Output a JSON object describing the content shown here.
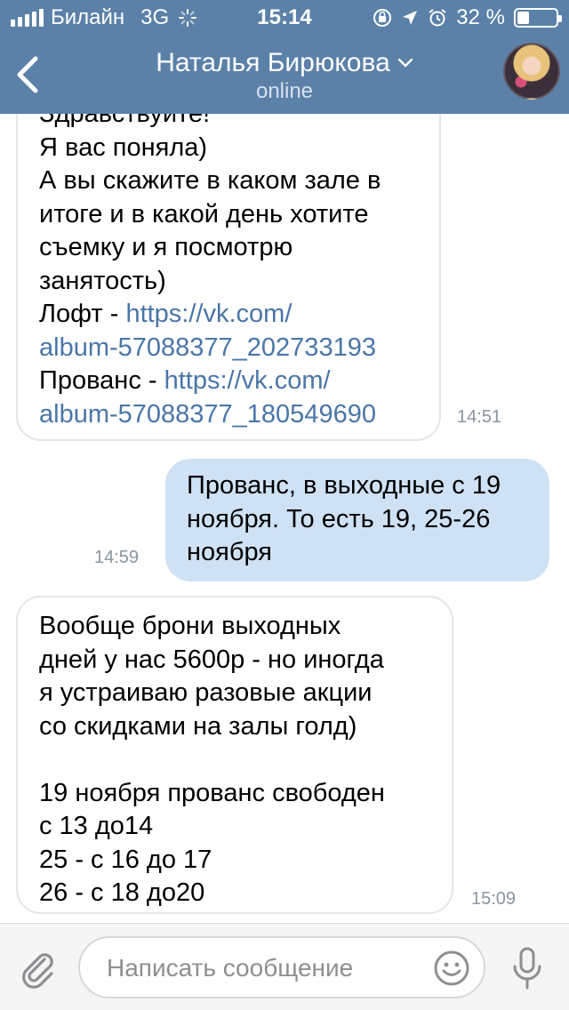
{
  "status_bar": {
    "carrier": "Билайн",
    "network": "3G",
    "time": "15:14",
    "battery_text": "32 %",
    "battery_level": 0.32
  },
  "header": {
    "contact_name": "Наталья Бирюкова",
    "status": "online",
    "icons": {
      "back": "chevron-left-icon",
      "dropdown": "chevron-down-icon"
    }
  },
  "messages": [
    {
      "direction": "incoming",
      "lines": [
        "Здравствуйте!",
        "Я вас поняла)",
        "А вы скажите в каком зале в",
        "итоге и в какой день хотите",
        "съемку и я посмотрю",
        "занятость)"
      ],
      "links": [
        {
          "label": "Лофт - ",
          "url_line1": "https://vk.com/",
          "url_line2": "album-57088377_202733193"
        },
        {
          "label": "Прованс - ",
          "url_line1": "https://vk.com/",
          "url_line2": "album-57088377_180549690"
        }
      ],
      "time": "14:51"
    },
    {
      "direction": "outgoing",
      "lines": [
        "Прованс, в выходные с 19",
        "ноября. То есть 19, 25-26",
        "ноября"
      ],
      "time": "14:59"
    },
    {
      "direction": "incoming",
      "lines": [
        "Вообще брони выходных",
        "дней у нас 5600р - но иногда",
        "я устраиваю разовые акции",
        "со скидками на залы голд)",
        "",
        "19 ноября прованс свободен",
        "с 13 до14",
        "25 - с 16 до 17",
        "26 - с 18 до20"
      ],
      "time": "15:09"
    }
  ],
  "composer": {
    "placeholder": "Написать сообщение",
    "icons": {
      "attach": "paperclip-icon",
      "emoji": "smiley-icon",
      "voice": "microphone-icon"
    }
  }
}
